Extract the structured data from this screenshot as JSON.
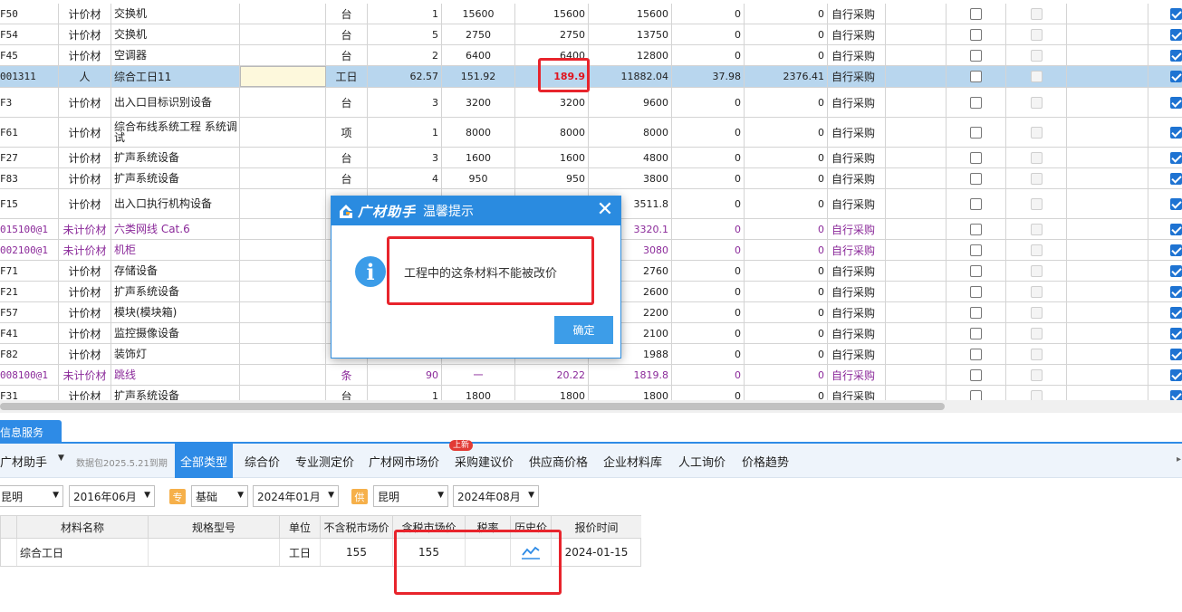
{
  "grid": {
    "rows": [
      {
        "code": "F50",
        "type": "计价材",
        "name": "交换机",
        "spec": "",
        "unit": "台",
        "qty": "1",
        "p1": "15600",
        "p2": "15600",
        "amt": "15600",
        "d1": "0",
        "d2": "0",
        "src": "自行采购"
      },
      {
        "code": "F54",
        "type": "计价材",
        "name": "交换机",
        "spec": "",
        "unit": "台",
        "qty": "5",
        "p1": "2750",
        "p2": "2750",
        "amt": "13750",
        "d1": "0",
        "d2": "0",
        "src": "自行采购"
      },
      {
        "code": "F45",
        "type": "计价材",
        "name": "空调器",
        "spec": "",
        "unit": "台",
        "qty": "2",
        "p1": "6400",
        "p2": "6400",
        "amt": "12800",
        "d1": "0",
        "d2": "0",
        "src": "自行采购"
      },
      {
        "code": "001311",
        "type": "人",
        "name": "综合工日11",
        "spec": "",
        "unit": "工日",
        "qty": "62.57",
        "p1": "151.92",
        "p2": "189.9",
        "amt": "11882.04",
        "d1": "37.98",
        "d2": "2376.41",
        "src": "自行采购"
      },
      {
        "code": "F3",
        "type": "计价材",
        "name": "出入口目标识别设备",
        "spec": "",
        "unit": "台",
        "qty": "3",
        "p1": "3200",
        "p2": "3200",
        "amt": "9600",
        "d1": "0",
        "d2": "0",
        "src": "自行采购"
      },
      {
        "code": "F61",
        "type": "计价材",
        "name": "综合布线系统工程 系统调试",
        "spec": "",
        "unit": "项",
        "qty": "1",
        "p1": "8000",
        "p2": "8000",
        "amt": "8000",
        "d1": "0",
        "d2": "0",
        "src": "自行采购"
      },
      {
        "code": "F27",
        "type": "计价材",
        "name": "扩声系统设备",
        "spec": "",
        "unit": "台",
        "qty": "3",
        "p1": "1600",
        "p2": "1600",
        "amt": "4800",
        "d1": "0",
        "d2": "0",
        "src": "自行采购"
      },
      {
        "code": "F83",
        "type": "计价材",
        "name": "扩声系统设备",
        "spec": "",
        "unit": "台",
        "qty": "4",
        "p1": "950",
        "p2": "950",
        "amt": "3800",
        "d1": "0",
        "d2": "0",
        "src": "自行采购"
      },
      {
        "code": "F15",
        "type": "计价材",
        "name": "出入口执行机构设备",
        "spec": "",
        "unit": "",
        "qty": "",
        "p1": "",
        "p2": "",
        "amt": "3511.8",
        "d1": "0",
        "d2": "0",
        "src": "自行采购"
      },
      {
        "code": "015100@1",
        "type": "未计价材",
        "name": "六类网线 Cat.6",
        "spec": "",
        "unit": "",
        "qty": "",
        "p1": "",
        "p2": "",
        "amt": "3320.1",
        "d1": "0",
        "d2": "0",
        "src": "自行采购"
      },
      {
        "code": "002100@1",
        "type": "未计价材",
        "name": "机柜",
        "spec": "",
        "unit": "",
        "qty": "",
        "p1": "",
        "p2": "",
        "amt": "3080",
        "d1": "0",
        "d2": "0",
        "src": "自行采购"
      },
      {
        "code": "F71",
        "type": "计价材",
        "name": "存储设备",
        "spec": "",
        "unit": "",
        "qty": "",
        "p1": "",
        "p2": "",
        "amt": "2760",
        "d1": "0",
        "d2": "0",
        "src": "自行采购"
      },
      {
        "code": "F21",
        "type": "计价材",
        "name": "扩声系统设备",
        "spec": "",
        "unit": "",
        "qty": "",
        "p1": "",
        "p2": "",
        "amt": "2600",
        "d1": "0",
        "d2": "0",
        "src": "自行采购"
      },
      {
        "code": "F57",
        "type": "计价材",
        "name": "模块(模块箱)",
        "spec": "",
        "unit": "",
        "qty": "",
        "p1": "",
        "p2": "",
        "amt": "2200",
        "d1": "0",
        "d2": "0",
        "src": "自行采购"
      },
      {
        "code": "F41",
        "type": "计价材",
        "name": "监控摄像设备",
        "spec": "",
        "unit": "",
        "qty": "",
        "p1": "",
        "p2": "",
        "amt": "2100",
        "d1": "0",
        "d2": "0",
        "src": "自行采购"
      },
      {
        "code": "F82",
        "type": "计价材",
        "name": "装饰灯",
        "spec": "",
        "unit": "",
        "qty": "",
        "p1": "",
        "p2": "",
        "amt": "1988",
        "d1": "0",
        "d2": "0",
        "src": "自行采购"
      },
      {
        "code": "008100@1",
        "type": "未计价材",
        "name": "跳线",
        "spec": "",
        "unit": "条",
        "qty": "90",
        "p1": "一",
        "p2": "20.22",
        "amt": "1819.8",
        "d1": "0",
        "d2": "0",
        "src": "自行采购"
      },
      {
        "code": "F31",
        "type": "计价材",
        "name": "扩声系统设备",
        "spec": "",
        "unit": "台",
        "qty": "1",
        "p1": "1800",
        "p2": "1800",
        "amt": "1800",
        "d1": "0",
        "d2": "0",
        "src": "自行采购"
      }
    ]
  },
  "dialog": {
    "brand": "广材助手",
    "title": "温馨提示",
    "close": "✕",
    "info_glyph": "i",
    "message": "工程中的这条材料不能被改价",
    "ok_label": "确定"
  },
  "panel": {
    "tab_label": "信息服务",
    "brand": "广材助手",
    "brand_caret": "▼",
    "package_date": "数据包2025.5.21到期",
    "new_badge": "上新",
    "tabs": [
      "全部类型",
      "综合价",
      "专业测定价",
      "广材网市场价",
      "采购建议价",
      "供应商价格",
      "企业材料库",
      "人工询价",
      "价格趋势"
    ],
    "filters": {
      "city1": "昆明",
      "date1": "2016年06月",
      "zhuan_tag": "专",
      "kind": "基础",
      "date2": "2024年01月",
      "gong_tag": "供",
      "city2": "昆明",
      "date3": "2024年08月"
    },
    "table": {
      "headers": [
        "材料名称",
        "规格型号",
        "单位",
        "不含税市场价",
        "含税市场价",
        "税率",
        "历史价",
        "报价时间"
      ],
      "row": {
        "name": "综合工日",
        "spec": "",
        "unit": "工日",
        "price_ex": "155",
        "price_in": "155",
        "tax": "",
        "history_icon": "trend-line-icon",
        "time": "2024-01-15"
      }
    }
  },
  "colors": {
    "accent": "#2e8be6",
    "selected_row": "#b8d6ee",
    "annotation_red": "#e8242c",
    "unpriced_purple": "#8b2a9a"
  }
}
